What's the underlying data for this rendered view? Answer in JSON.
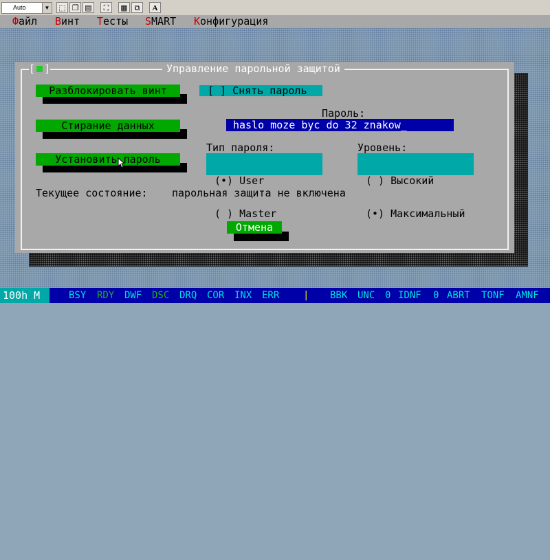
{
  "toolbar": {
    "font_select_value": "Auto",
    "font_button_label": "A"
  },
  "menu": {
    "items": [
      {
        "hot": "Ф",
        "rest": "айл"
      },
      {
        "hot": "В",
        "rest": "инт"
      },
      {
        "hot": "Т",
        "rest": "есты"
      },
      {
        "hot": "S",
        "rest": "MART"
      },
      {
        "hot": "К",
        "rest": "онфигурация"
      }
    ]
  },
  "dialog": {
    "title": "Управление парольной защитой",
    "close_box_left": "[",
    "close_box_right": "]",
    "unlock_button": "Разблокировать винт",
    "erase_button": "Стирание данных",
    "set_password_button": "Установить пароль",
    "remove_password_checkbox": "[ ] Снять пароль",
    "password_label": "Пароль:",
    "password_value": "haslo moze byc do 32 znakow_",
    "password_type_label": "Тип пароля:",
    "password_type_options": [
      "(•) User",
      "( ) Master"
    ],
    "level_label": "Уровень:",
    "level_options": [
      "( ) Высокий",
      "(•) Максимальный"
    ],
    "status_label": "Текущее состояние:",
    "status_value": "парольная защита не включена",
    "cancel_button": "Отмена"
  },
  "statusbar": {
    "address": "100h M",
    "flags_left": [
      "BSY",
      "RDY",
      "DWF",
      "DSC",
      "DRQ",
      "COR",
      "INX",
      "ERR"
    ],
    "separator": "|",
    "flags_right": [
      "BBK",
      "UNC",
      "0",
      "IDNF",
      "0",
      "ABRT",
      "TONF",
      "AMNF"
    ],
    "colors": {
      "active": "#22b022",
      "inactive": "#00e0e0",
      "separator": "#e8e800"
    }
  }
}
